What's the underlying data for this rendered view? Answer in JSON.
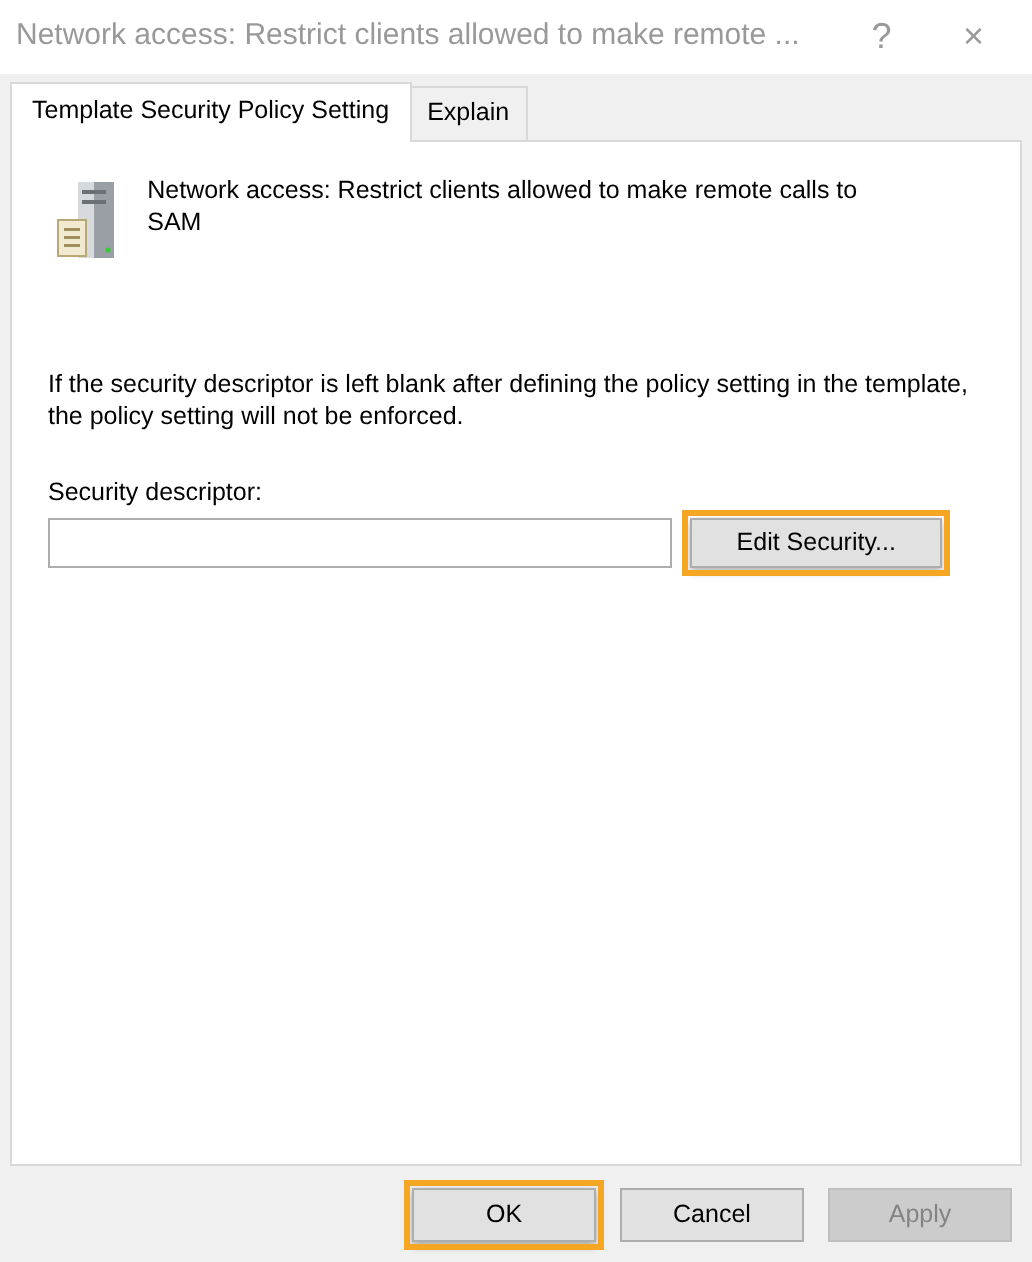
{
  "window": {
    "title": "Network access: Restrict clients allowed to make remote ...",
    "help": "?",
    "close": "×"
  },
  "tabs": [
    {
      "label": "Template Security Policy Setting",
      "selected": true
    },
    {
      "label": "Explain",
      "selected": false
    }
  ],
  "policy": {
    "name": "Network access: Restrict clients allowed to make remote calls to SAM"
  },
  "note": "If the security descriptor is left blank after defining the policy setting in the template, the policy setting will not be enforced.",
  "descriptor": {
    "label": "Security descriptor:",
    "button": {
      "label": "Edit Security...",
      "highlighted": true
    }
  },
  "buttons": [
    {
      "label": "OK",
      "highlighted": true,
      "disabled": false
    },
    {
      "label": "Cancel",
      "highlighted": false,
      "disabled": false
    },
    {
      "label": "Apply",
      "highlighted": false,
      "disabled": true
    }
  ]
}
